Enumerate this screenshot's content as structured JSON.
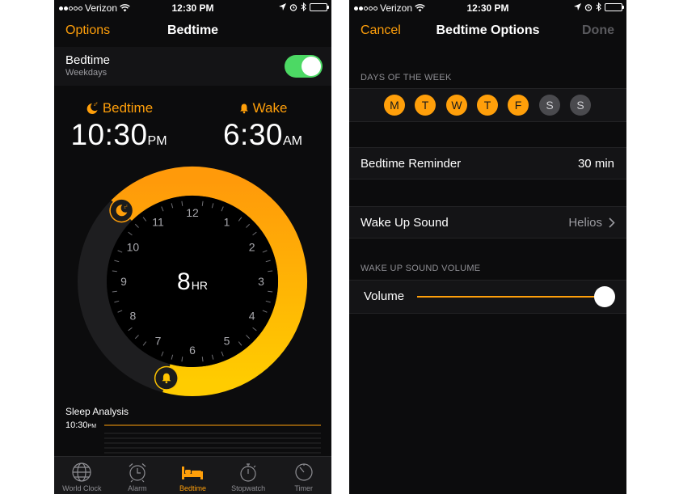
{
  "status": {
    "carrier": "Verizon",
    "time": "12:30 PM"
  },
  "left": {
    "nav": {
      "left_button": "Options",
      "title": "Bedtime"
    },
    "bedtime_row": {
      "label": "Bedtime",
      "sublabel": "Weekdays",
      "enabled": true
    },
    "bedtime": {
      "label": "Bedtime",
      "time": "10:30",
      "ampm": "PM"
    },
    "wake": {
      "label": "Wake",
      "time": "6:30",
      "ampm": "AM"
    },
    "clock": {
      "duration_value": "8",
      "duration_unit": "HR",
      "numbers": [
        "12",
        "1",
        "2",
        "3",
        "4",
        "5",
        "6",
        "7",
        "8",
        "9",
        "10",
        "11"
      ],
      "start_hour": 22.5,
      "end_hour": 30.5
    },
    "sleep_analysis": {
      "title": "Sleep Analysis",
      "time": "10:30",
      "ampm": "PM"
    },
    "tabs": [
      {
        "label": "World Clock",
        "icon": "globe-icon",
        "active": false
      },
      {
        "label": "Alarm",
        "icon": "alarm-clock-icon",
        "active": false
      },
      {
        "label": "Bedtime",
        "icon": "bed-icon",
        "active": true
      },
      {
        "label": "Stopwatch",
        "icon": "stopwatch-icon",
        "active": false
      },
      {
        "label": "Timer",
        "icon": "timer-icon",
        "active": false
      }
    ]
  },
  "right": {
    "nav": {
      "left_button": "Cancel",
      "title": "Bedtime Options",
      "right_button": "Done"
    },
    "days_header": "DAYS OF THE WEEK",
    "days": [
      {
        "letter": "M",
        "selected": true
      },
      {
        "letter": "T",
        "selected": true
      },
      {
        "letter": "W",
        "selected": true
      },
      {
        "letter": "T",
        "selected": true
      },
      {
        "letter": "F",
        "selected": true
      },
      {
        "letter": "S",
        "selected": false
      },
      {
        "letter": "S",
        "selected": false
      }
    ],
    "reminder": {
      "label": "Bedtime Reminder",
      "value": "30 min"
    },
    "wake_sound": {
      "label": "Wake Up Sound",
      "value": "Helios"
    },
    "volume_header": "WAKE UP SOUND VOLUME",
    "volume": {
      "label": "Volume",
      "level": 1.0
    }
  },
  "colors": {
    "accent": "#ff9f0a",
    "toggle_on": "#4cd964",
    "background": "#0c0c0d"
  }
}
